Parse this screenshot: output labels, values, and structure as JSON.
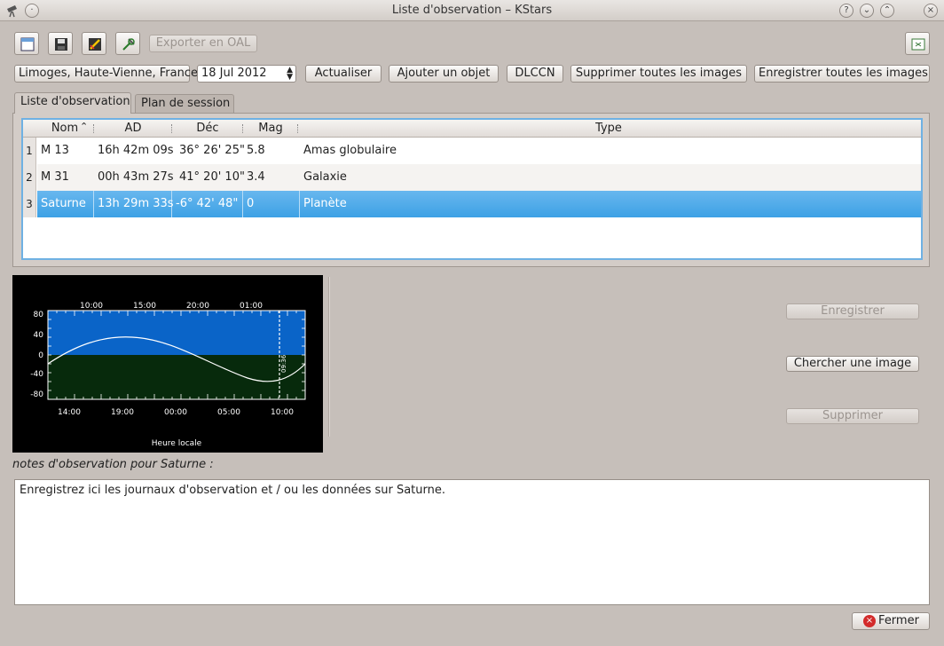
{
  "window": {
    "title": "Liste d'observation – KStars"
  },
  "toolbar": {
    "export_label": "Exporter en OAL",
    "location": "Limoges, Haute-Vienne, France",
    "date": "18 Jul 2012",
    "update_label": "Actualiser",
    "add_object_label": "Ajouter un objet",
    "dlccn_label": "DLCCN",
    "delete_images_label": "Supprimer toutes les images",
    "save_images_label": "Enregistrer toutes les images"
  },
  "tabs": [
    {
      "label": "Liste d'observation"
    },
    {
      "label": "Plan de session"
    }
  ],
  "table": {
    "columns": [
      "Nom",
      "AD",
      "Déc",
      "Mag",
      "Type"
    ],
    "rows": [
      {
        "num": "1",
        "nom": "M 13",
        "ad": "16h 42m 09s",
        "dec": "36° 26' 25\"",
        "mag": "5.8",
        "type": "Amas globulaire"
      },
      {
        "num": "2",
        "nom": "M 31",
        "ad": "00h 43m 27s",
        "dec": "41° 20' 10\"",
        "mag": "3.4",
        "type": "Galaxie"
      },
      {
        "num": "3",
        "nom": "Saturne",
        "ad": "13h 29m 33s",
        "dec": "-6° 42' 48\"",
        "mag": "0",
        "type": "Planète"
      }
    ]
  },
  "plot": {
    "top_ticks": [
      "10:00",
      "15:00",
      "20:00",
      "01:00"
    ],
    "bottom_ticks": [
      "14:00",
      "19:00",
      "00:00",
      "05:00",
      "10:00"
    ],
    "y_ticks": [
      "80",
      "40",
      "0",
      "-40",
      "-80"
    ],
    "now_label": "09:36",
    "xlabel": "Heure locale",
    "colors": {
      "sky": "#0a64c8",
      "ground": "#072a0c"
    }
  },
  "side_buttons": {
    "save_label": "Enregistrer",
    "search_image_label": "Chercher une image",
    "delete_label": "Supprimer"
  },
  "notes": {
    "label": "notes d'observation pour Saturne :",
    "text": "Enregistrez ici les journaux d'observation et / ou les données sur Saturne."
  },
  "footer": {
    "close_label": "Fermer"
  }
}
